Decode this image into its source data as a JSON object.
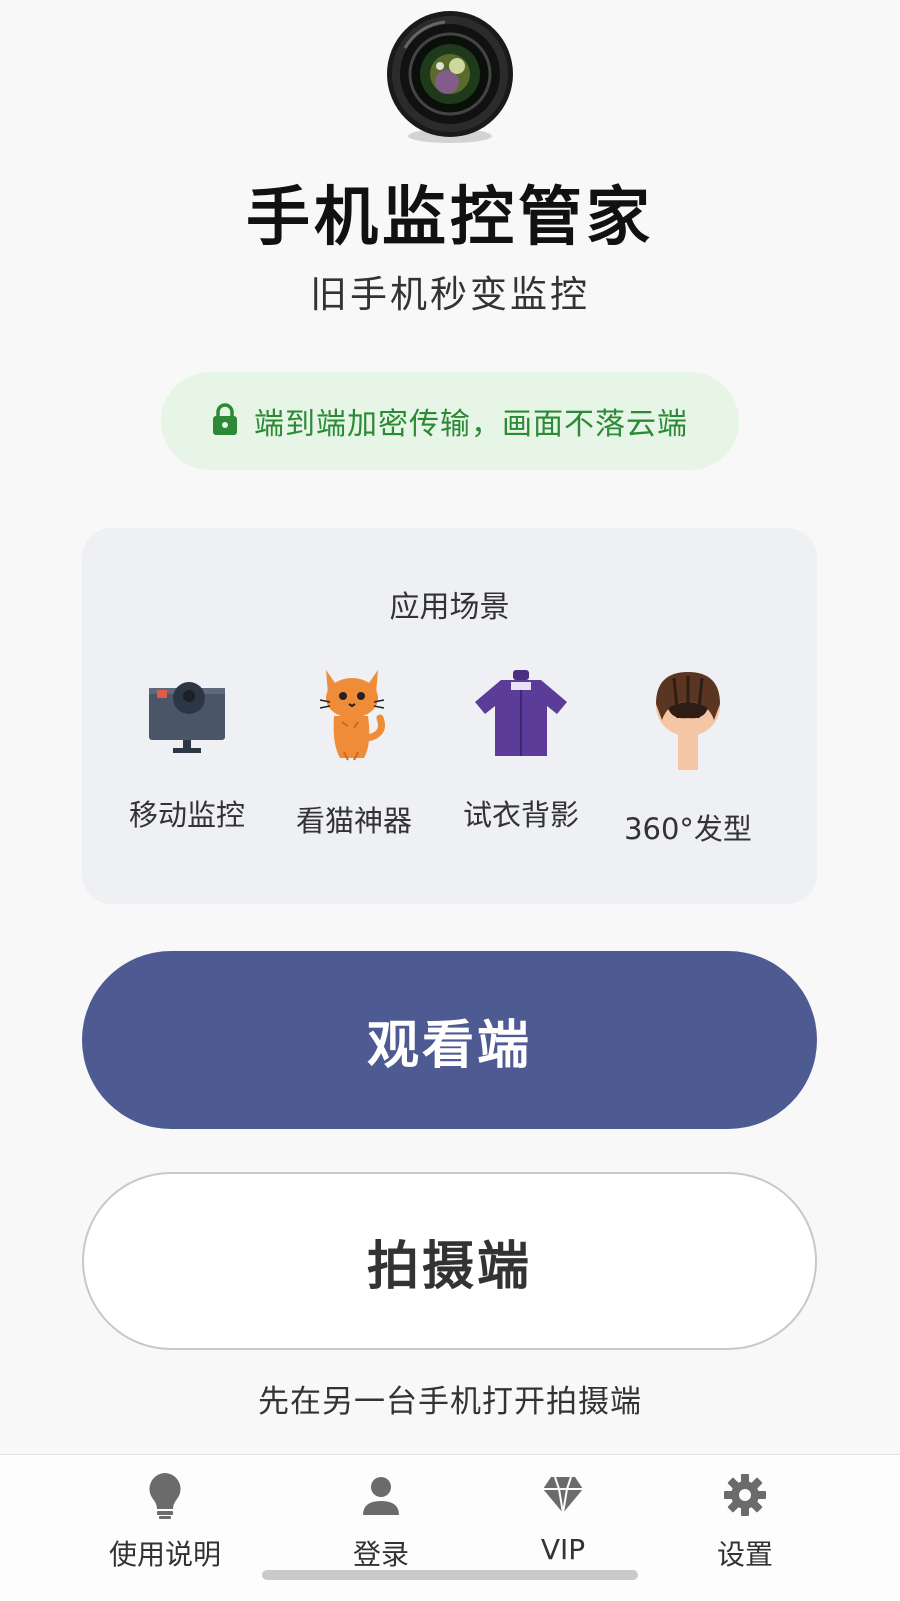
{
  "app": {
    "title": "手机监控管家",
    "subtitle": "旧手机秒变监控",
    "logo_icon": "camera-lens-icon"
  },
  "security": {
    "icon": "lock-icon",
    "text": "端到端加密传输，画面不落云端",
    "color": "#2c8a36",
    "background": "#e6f5e6"
  },
  "scenes": {
    "title": "应用场景",
    "items": [
      {
        "label": "移动监控",
        "icon": "webcam-monitor-icon"
      },
      {
        "label": "看猫神器",
        "icon": "cat-icon"
      },
      {
        "label": "试衣背影",
        "icon": "shirt-icon"
      },
      {
        "label": "360°发型",
        "icon": "hairstyle-head-icon"
      }
    ]
  },
  "buttons": {
    "viewer": "观看端",
    "camera": "拍摄端",
    "primary_color": "#4d5b92"
  },
  "hint": "先在另一台手机打开拍摄端",
  "nav": {
    "items": [
      {
        "label": "使用说明",
        "icon": "lightbulb-icon"
      },
      {
        "label": "登录",
        "icon": "user-icon"
      },
      {
        "label": "VIP",
        "icon": "diamond-icon"
      },
      {
        "label": "设置",
        "icon": "gear-icon"
      }
    ]
  }
}
